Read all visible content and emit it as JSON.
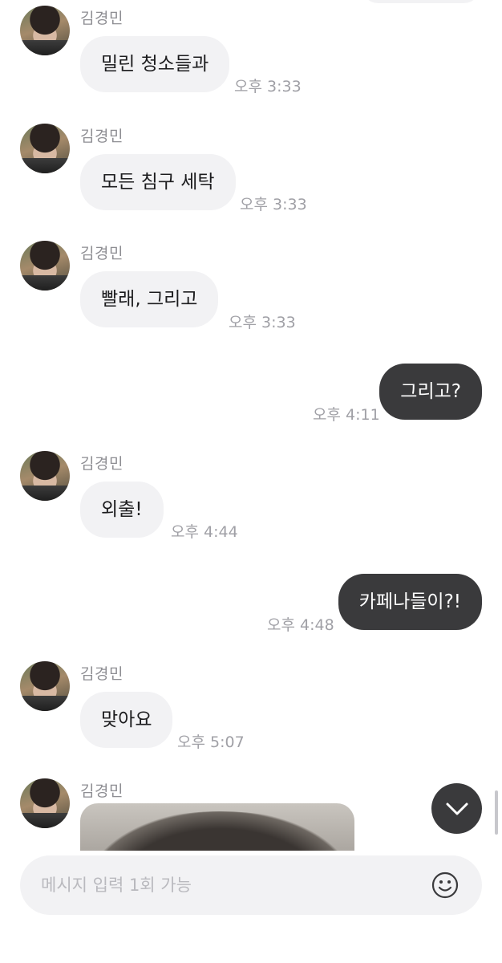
{
  "messages": {
    "m1": {
      "sender": "김경민",
      "text": "밀린 청소들과",
      "time": "오후 3:33"
    },
    "m2": {
      "sender": "김경민",
      "text": "모든 침구 세탁",
      "time": "오후 3:33"
    },
    "m3": {
      "sender": "김경민",
      "text": "빨래, 그리고",
      "time": "오후 3:33"
    },
    "m4": {
      "text": "그리고?",
      "time": "오후 4:11"
    },
    "m5": {
      "sender": "김경민",
      "text": "외출!",
      "time": "오후 4:44"
    },
    "m6": {
      "text": "카페나들이?!",
      "time": "오후 4:48"
    },
    "m7": {
      "sender": "김경민",
      "text": "맞아요",
      "time": "오후 5:07"
    },
    "m8": {
      "sender": "김경민"
    }
  },
  "composer": {
    "placeholder": "메시지 입력 1회 가능"
  },
  "icons": {
    "scroll_down": "chevron-down-icon",
    "emoji": "smiley-icon"
  },
  "colors": {
    "incoming_bubble": "#f2f2f4",
    "outgoing_bubble": "#3a3a3c",
    "timestamp": "#a0a0a6"
  }
}
